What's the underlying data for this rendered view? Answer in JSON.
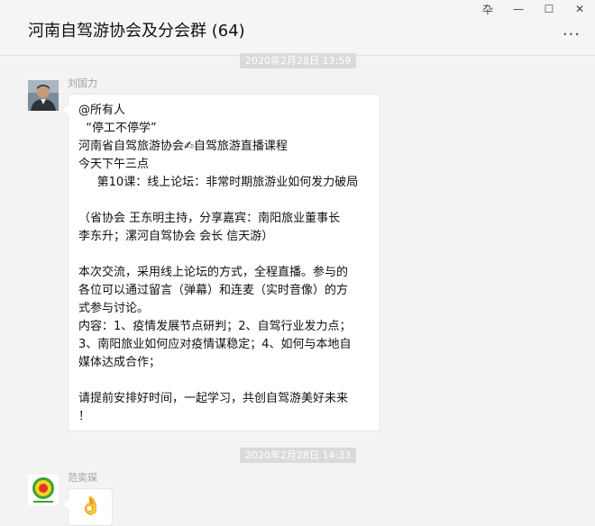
{
  "window": {
    "title": "河南自驾游协会及分会群 (64)",
    "controls": {
      "pin": "卆",
      "minimize": "—",
      "maximize": "☐",
      "close": "✕"
    },
    "more": "···"
  },
  "messages": [
    {
      "time": "2020年2月28日 13:59",
      "sender": "刘国力",
      "avatar_icon": "person-photo-avatar",
      "lines": [
        "@所有人",
        "  “停工不停学”",
        "河南省自驾旅游协会✍自驾旅游直播课程",
        "今天下午三点",
        "     第10课：线上论坛：非常时期旅游业如何发力破局",
        "",
        "（省协会 王东明主持，分享嘉宾：南阳旅业董事长",
        "李东升；漯河自驾协会 会长 信天游）",
        "",
        "本次交流，采用线上论坛的方式，全程直播。参与的",
        "各位可以通过留言（弹幕）和连麦（实时音像）的方",
        "式参与讨论。",
        "内容：1、疫情发展节点研判；2、自驾行业发力点；",
        "3、南阳旅业如何应对疫情谋稳定；4、如何与本地自",
        "媒体达成合作；",
        "",
        "请提前安排好时间，一起学习，共创自驾游美好未来",
        "！"
      ]
    },
    {
      "time": "2020年2月28日 14:33",
      "sender": "范奕琛",
      "avatar_icon": "green-logo-avatar",
      "emoji": "👌"
    }
  ]
}
